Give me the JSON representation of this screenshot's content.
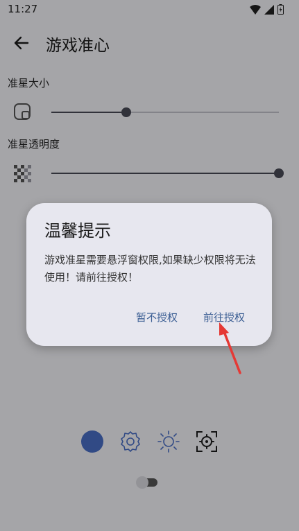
{
  "status_bar": {
    "time": "11:27"
  },
  "app_bar": {
    "title": "游戏准心",
    "back_icon": "arrow-back-icon"
  },
  "settings": {
    "size_label": "准星大小",
    "size_value": 0.33,
    "opacity_label": "准星透明度",
    "opacity_value": 1.0
  },
  "bottom_bar": {
    "icons": [
      "color-dot-icon",
      "gear-icon",
      "brightness-icon",
      "crosshair-icon"
    ],
    "accent": "#4a6fc7",
    "toggle_on": false
  },
  "dialog": {
    "title": "温馨提示",
    "message": "游戏准星需要悬浮窗权限,如果缺少权限将无法使用！请前往授权！",
    "deny_label": "暂不授权",
    "allow_label": "前往授权",
    "button_color": "#3c5f94"
  },
  "annotation": {
    "arrow_color": "#e53935"
  }
}
